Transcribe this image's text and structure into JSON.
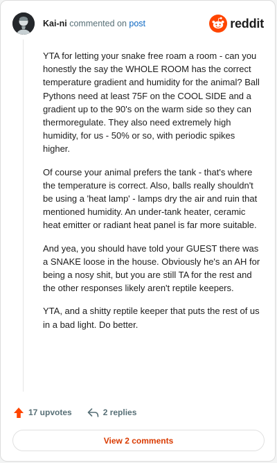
{
  "header": {
    "username": "Kai-ni",
    "action_text": "commented on",
    "post_link": "post",
    "logo_text": "reddit"
  },
  "comment": {
    "paragraphs": [
      "YTA for letting your snake free roam a room - can you honestly the say the WHOLE ROOM has the correct temperature gradient and humidity for the animal? Ball Pythons need at least 75F on the COOL SIDE and a gradient up to the 90's on the warm side so they can thermoregulate. They also need extremely high humidity, for us - 50% or so, with periodic spikes higher.",
      "Of course your animal prefers the tank - that's where the temperature is correct. Also, balls really shouldn't be using a 'heat lamp' - lamps dry the air and ruin that mentioned humidity. An under-tank heater, ceramic heat emitter or radiant heat panel is far more suitable.",
      "And yea, you should have told your GUEST there was a SNAKE loose in the house. Obviously he's an AH for being a nosy shit, but you are still TA for the rest and the other responses likely aren't reptile keepers.",
      "YTA, and a shitty reptile keeper that puts the rest of us in a bad light. Do better."
    ]
  },
  "actions": {
    "upvotes": "17 upvotes",
    "replies": "2 replies"
  },
  "footer": {
    "view_comments": "View 2 comments"
  },
  "colors": {
    "reddit_orange": "#ff4500",
    "upvote": "#ff4500",
    "view_button_text": "#d93a00",
    "link": "#0a66c2"
  },
  "icons": {
    "avatar": "avatar",
    "logo": "reddit-snoo-icon",
    "upvote": "upvote-arrow-icon",
    "reply": "reply-arrow-icon"
  }
}
